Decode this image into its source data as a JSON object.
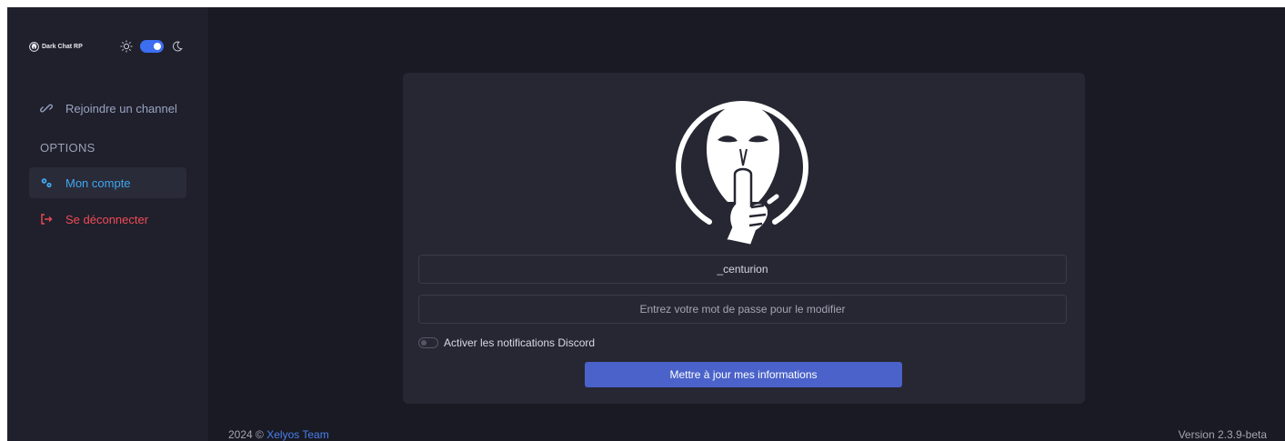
{
  "app": {
    "name": "Dark Chat RP",
    "theme_toggle_on": true
  },
  "sidebar": {
    "join_channel_label": "Rejoindre un channel",
    "section_label": "OPTIONS",
    "account_label": "Mon compte",
    "logout_label": "Se déconnecter"
  },
  "account_form": {
    "username_value": "_centurion",
    "password_placeholder": "Entrez votre mot de passe pour le modifier",
    "notifications_label": "Activer les notifications Discord",
    "notifications_enabled": false,
    "submit_label": "Mettre à jour mes informations"
  },
  "footer": {
    "copyright_prefix": "2024 © ",
    "team_link": "Xelyos Team",
    "version": "Version 2.3.9-beta"
  },
  "colors": {
    "background": "#191a23",
    "sidebar": "#1f202c",
    "card": "#262732",
    "accent_blue": "#3fa7f0",
    "danger_red": "#f04a55",
    "primary_button": "#4a62c9"
  },
  "icons": {
    "brand": "masked-face-icon",
    "sun": "sun-icon",
    "moon": "moon-icon",
    "join": "link-icon",
    "account": "gears-icon",
    "logout": "logout-icon"
  }
}
